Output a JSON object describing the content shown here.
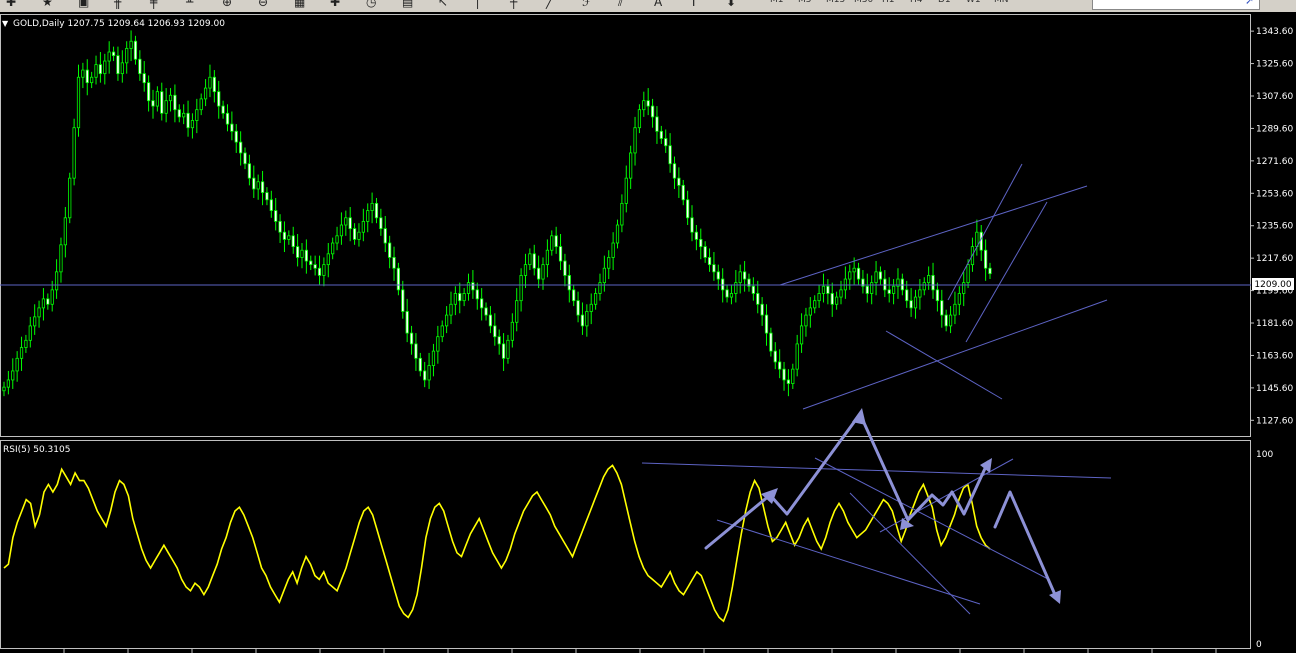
{
  "toolbar": {
    "tools": [
      {
        "name": "new-order-icon",
        "glyph": "✚"
      },
      {
        "name": "favorites-icon",
        "glyph": "★"
      },
      {
        "name": "save-icon",
        "glyph": "▣"
      },
      {
        "name": "bar-chart-icon",
        "glyph": "╫"
      },
      {
        "name": "candlestick-icon",
        "glyph": "╪"
      },
      {
        "name": "line-chart-icon",
        "glyph": "╨"
      },
      {
        "name": "zoom-in-icon",
        "glyph": "⊕"
      },
      {
        "name": "zoom-out-icon",
        "glyph": "⊖"
      },
      {
        "name": "grid-icon",
        "glyph": "▦"
      },
      {
        "name": "indicators-icon",
        "glyph": "✚"
      },
      {
        "name": "periods-icon",
        "glyph": "◷"
      },
      {
        "name": "templates-icon",
        "glyph": "▤"
      },
      {
        "name": "cursor-icon",
        "glyph": "↖"
      },
      {
        "name": "vertical-line-icon",
        "glyph": "│"
      },
      {
        "name": "crosshair-icon",
        "glyph": "┼"
      },
      {
        "name": "trendline-icon",
        "glyph": "╱"
      },
      {
        "name": "fibo-icon",
        "glyph": "ℱ"
      },
      {
        "name": "channel-icon",
        "glyph": "⫽"
      },
      {
        "name": "text-icon",
        "glyph": "A"
      },
      {
        "name": "label-icon",
        "glyph": "T"
      },
      {
        "name": "arrows-icon",
        "glyph": "⬍"
      }
    ],
    "timeframes": [
      "M1",
      "M5",
      "M15",
      "M30",
      "H1",
      "H4",
      "D1",
      "W1",
      "MN"
    ]
  },
  "chart_data": [
    {
      "type": "candlestick",
      "title": "GOLD,Daily  1207.75 1209.64 1206.93 1209.00",
      "current_price_label": "1209.00",
      "current_price": 1209.0,
      "ylim": [
        1120,
        1352
      ],
      "yticks": [
        "1343.60",
        "1325.60",
        "1307.60",
        "1289.60",
        "1271.60",
        "1253.60",
        "1235.60",
        "1217.60",
        "1199.60",
        "1181.60",
        "1163.60",
        "1145.60",
        "1127.60"
      ],
      "closes": [
        1146,
        1150,
        1155,
        1162,
        1168,
        1172,
        1180,
        1185,
        1190,
        1195,
        1192,
        1200,
        1210,
        1225,
        1240,
        1262,
        1290,
        1318,
        1322,
        1315,
        1318,
        1325,
        1320,
        1327,
        1332,
        1330,
        1320,
        1326,
        1334,
        1338,
        1328,
        1320,
        1315,
        1305,
        1302,
        1310,
        1298,
        1305,
        1308,
        1300,
        1296,
        1298,
        1290,
        1294,
        1300,
        1306,
        1312,
        1318,
        1310,
        1302,
        1298,
        1292,
        1288,
        1282,
        1276,
        1270,
        1262,
        1256,
        1260,
        1254,
        1250,
        1244,
        1238,
        1232,
        1228,
        1230,
        1224,
        1218,
        1222,
        1216,
        1214,
        1212,
        1208,
        1214,
        1220,
        1226,
        1230,
        1236,
        1240,
        1234,
        1228,
        1232,
        1238,
        1244,
        1248,
        1240,
        1234,
        1226,
        1218,
        1212,
        1200,
        1188,
        1176,
        1170,
        1162,
        1155,
        1150,
        1158,
        1166,
        1174,
        1180,
        1186,
        1192,
        1198,
        1194,
        1198,
        1204,
        1200,
        1195,
        1190,
        1186,
        1180,
        1174,
        1170,
        1162,
        1172,
        1182,
        1194,
        1208,
        1214,
        1220,
        1212,
        1206,
        1214,
        1222,
        1230,
        1224,
        1216,
        1208,
        1200,
        1194,
        1186,
        1180,
        1188,
        1192,
        1198,
        1204,
        1212,
        1218,
        1226,
        1236,
        1248,
        1262,
        1276,
        1290,
        1300,
        1305,
        1302,
        1296,
        1288,
        1284,
        1280,
        1270,
        1262,
        1258,
        1250,
        1240,
        1232,
        1228,
        1224,
        1218,
        1214,
        1210,
        1206,
        1200,
        1196,
        1198,
        1204,
        1210,
        1206,
        1202,
        1198,
        1192,
        1186,
        1176,
        1166,
        1160,
        1156,
        1150,
        1148,
        1156,
        1170,
        1180,
        1186,
        1190,
        1194,
        1198,
        1202,
        1198,
        1192,
        1196,
        1200,
        1206,
        1210,
        1212,
        1206,
        1202,
        1198,
        1204,
        1210,
        1206,
        1200,
        1198,
        1202,
        1206,
        1200,
        1194,
        1190,
        1196,
        1200,
        1204,
        1208,
        1200,
        1194,
        1186,
        1180,
        1186,
        1192,
        1198,
        1204,
        1214,
        1224,
        1232,
        1222,
        1212,
        1209
      ]
    },
    {
      "type": "line",
      "title": "RSI(5) 50.3105",
      "ylim": [
        0,
        100
      ],
      "yticks": [
        "100",
        "0"
      ],
      "values": [
        40,
        42,
        56,
        64,
        70,
        76,
        74,
        62,
        68,
        80,
        84,
        80,
        84,
        92,
        88,
        84,
        90,
        86,
        86,
        82,
        76,
        70,
        66,
        62,
        70,
        80,
        86,
        84,
        78,
        66,
        58,
        50,
        44,
        40,
        44,
        48,
        52,
        48,
        44,
        40,
        34,
        30,
        28,
        32,
        30,
        26,
        30,
        36,
        42,
        50,
        56,
        64,
        70,
        72,
        68,
        62,
        56,
        48,
        40,
        36,
        30,
        26,
        22,
        28,
        34,
        38,
        32,
        40,
        46,
        42,
        36,
        34,
        38,
        32,
        30,
        28,
        34,
        40,
        48,
        56,
        64,
        70,
        72,
        68,
        60,
        52,
        44,
        36,
        28,
        20,
        16,
        14,
        18,
        26,
        40,
        56,
        66,
        72,
        74,
        70,
        62,
        54,
        48,
        46,
        52,
        58,
        62,
        66,
        60,
        54,
        48,
        44,
        40,
        44,
        50,
        58,
        64,
        70,
        74,
        78,
        80,
        76,
        72,
        68,
        62,
        58,
        54,
        50,
        46,
        52,
        58,
        64,
        70,
        76,
        82,
        88,
        92,
        94,
        90,
        84,
        74,
        64,
        54,
        46,
        40,
        36,
        34,
        32,
        30,
        34,
        38,
        32,
        28,
        26,
        30,
        34,
        38,
        36,
        30,
        24,
        18,
        14,
        12,
        18,
        30,
        44,
        58,
        70,
        80,
        86,
        82,
        72,
        62,
        54,
        56,
        60,
        64,
        58,
        52,
        56,
        62,
        66,
        60,
        54,
        50,
        56,
        64,
        70,
        74,
        70,
        64,
        60,
        56,
        58,
        60,
        64,
        68,
        72,
        76,
        74,
        70,
        62,
        54,
        60,
        68,
        74,
        80,
        84,
        78,
        72,
        60,
        52,
        56,
        62,
        68,
        76,
        82,
        84,
        74,
        62,
        56,
        52,
        50
      ]
    }
  ]
}
